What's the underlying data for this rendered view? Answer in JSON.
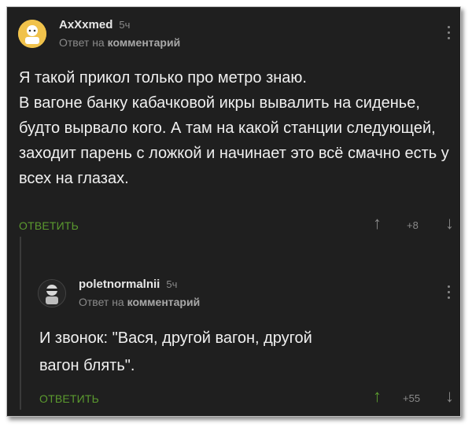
{
  "comments": [
    {
      "author": "AxXxmed",
      "time": "5ч",
      "reply_prefix": "Ответ на",
      "reply_target": "комментарий",
      "text": "Я такой прикол только про метро знаю.\nВ вагоне банку кабачковой икры вывалить на сиденье, будто вырвало кого. А там на какой станции следующей, заходит парень с ложкой и начинает это всё смачно есть у всех на глазах.",
      "reply_label": "ОТВЕТИТЬ",
      "rating": "+8"
    },
    {
      "author": "poletnormalnii",
      "time": "5ч",
      "reply_prefix": "Ответ на",
      "reply_target": "комментарий",
      "text": "И звонок: \"Вася, другой вагон, другой\nвагон блять\".",
      "reply_label": "ОТВЕТИТЬ",
      "rating": "+55"
    }
  ],
  "icons": {
    "up": "arrow-up-icon",
    "down": "arrow-down-icon",
    "menu": "more-vertical-icon"
  },
  "colors": {
    "background": "#1f1f1f",
    "accent_green": "#5b9a2f",
    "text": "#f0f0f0",
    "muted": "#8a8a8a"
  }
}
